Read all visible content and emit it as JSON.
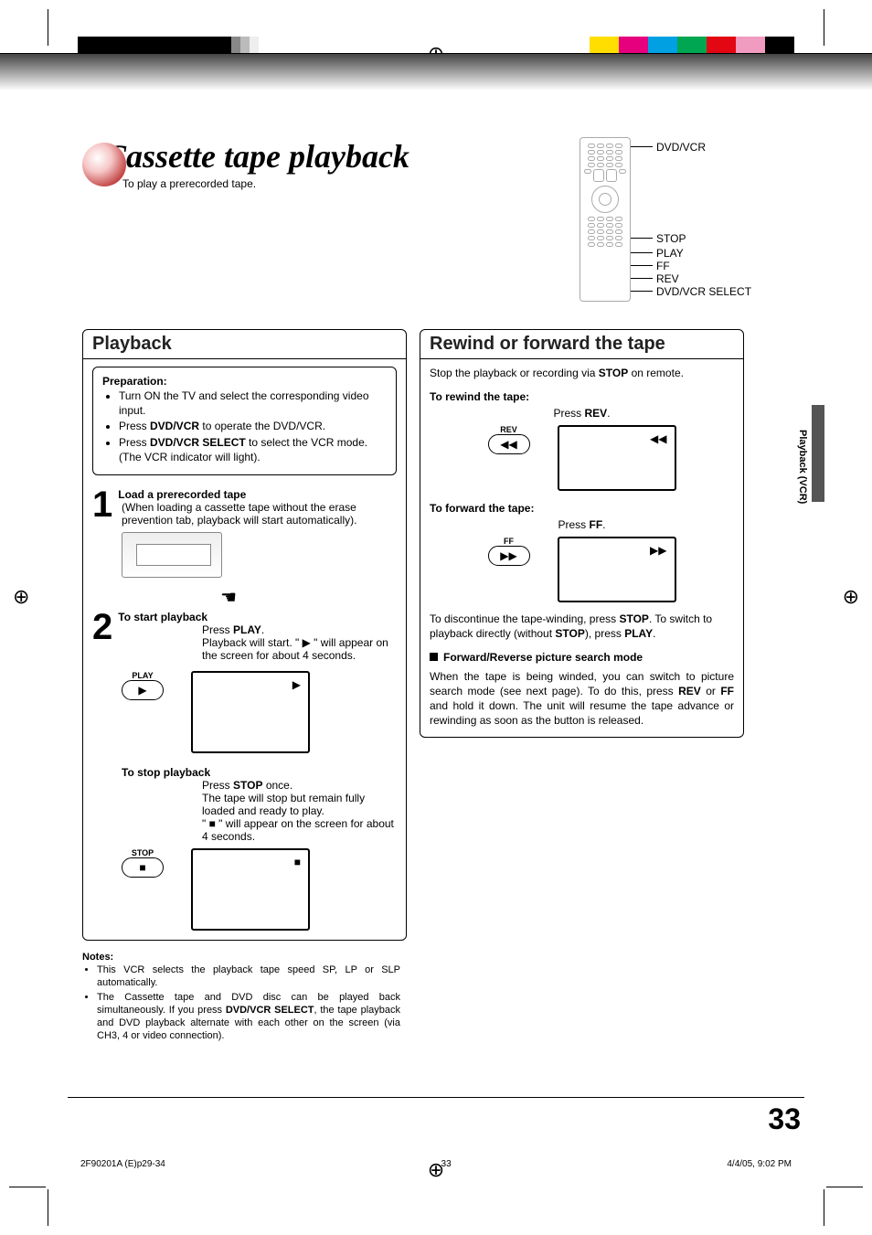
{
  "title": "Cassette tape playback",
  "subtitle": "To play a prerecorded tape.",
  "remote_labels": {
    "dvd_vcr": "DVD/VCR",
    "stop": "STOP",
    "play": "PLAY",
    "ff": "FF",
    "rev": "REV",
    "select": "DVD/VCR SELECT"
  },
  "left_panel": {
    "title": "Playback",
    "prep_heading": "Preparation:",
    "prep_bullets": [
      {
        "pre": "Turn ON the TV and select the corresponding video input."
      },
      {
        "pre": "Press ",
        "bold": "DVD/VCR",
        "post": " to operate the DVD/VCR."
      },
      {
        "pre": "Press ",
        "bold": "DVD/VCR SELECT",
        "post": " to select the VCR mode. (The VCR indicator will light)."
      }
    ],
    "step1": {
      "num": "1",
      "heading": "Load a prerecorded tape",
      "body": "(When loading a cassette tape without the erase prevention tab, playback will start automatically)."
    },
    "step2": {
      "num": "2",
      "heading": "To start playback",
      "press_pre": "Press ",
      "press_bold": "PLAY",
      "press_post": ".",
      "body": "Playback will start. \" ▶ \" will appear on the screen for about 4 seconds.",
      "btn_label": "PLAY",
      "screen_glyph": "▶"
    },
    "stop": {
      "heading": "To stop playback",
      "press_pre": "Press ",
      "press_bold": "STOP",
      "press_post": " once.",
      "body1": "The tape will stop but remain fully loaded and ready to play.",
      "body2": "\" ■ \" will appear on the screen for about 4 seconds.",
      "btn_label": "STOP",
      "screen_glyph": "■"
    }
  },
  "right_panel": {
    "title": "Rewind or forward the tape",
    "intro_pre": "Stop the playback or recording via ",
    "intro_bold": "STOP",
    "intro_post": " on remote.",
    "rewind": {
      "heading": "To rewind the tape:",
      "press_pre": "Press ",
      "press_bold": "REV",
      "press_post": ".",
      "btn_label": "REV",
      "screen_glyph": "◀◀"
    },
    "forward": {
      "heading": "To forward the tape:",
      "press_pre": "Press ",
      "press_bold": "FF",
      "press_post": ".",
      "btn_label": "FF",
      "screen_glyph": "▶▶"
    },
    "discontinue": {
      "part1": "To discontinue the tape-winding, press ",
      "b1": "STOP",
      "part2": ". To switch to playback directly (without ",
      "b2": "STOP",
      "part3": "), press ",
      "b3": "PLAY",
      "part4": "."
    },
    "search_heading": "Forward/Reverse picture search mode",
    "search_body": {
      "part1": "When the tape is being winded, you can switch to picture search mode (see next page). To do this, press ",
      "b1": "REV",
      "part2": " or ",
      "b2": "FF",
      "part3": " and hold it down. The unit will resume the tape advance or rewinding as soon as the button is released."
    }
  },
  "notes": {
    "heading": "Notes:",
    "items": [
      "This VCR selects the playback tape speed SP, LP or SLP automatically.",
      {
        "pre": "The Cassette tape and DVD disc can be played back simultaneously. If you press ",
        "bold": "DVD/VCR SELECT",
        "post": ", the tape playback and DVD playback alternate with each other on the screen (via CH3, 4 or video connection)."
      }
    ]
  },
  "side_tab": "Playback (VCR)",
  "page_number": "33",
  "footer": {
    "left": "2F90201A (E)p29-34",
    "mid": "33",
    "right": "4/4/05, 9:02 PM"
  }
}
